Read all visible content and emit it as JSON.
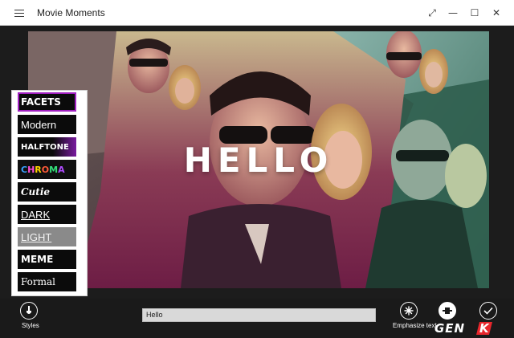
{
  "window": {
    "title": "Movie Moments",
    "menu_icon": "hamburger-icon",
    "controls": [
      "expand-icon",
      "minimize-icon",
      "maximize-icon",
      "close-icon"
    ],
    "control_glyphs": {
      "expand": "⤢",
      "minimize": "—",
      "maximize": "☐",
      "close": "✕"
    }
  },
  "preview": {
    "overlay_text": "HELLO"
  },
  "styles_panel": {
    "items": [
      {
        "label": "FACETS",
        "selected": true
      },
      {
        "label": "Modern",
        "selected": false
      },
      {
        "label": "HALFTONE",
        "selected": false
      },
      {
        "label": "CHROMA",
        "selected": false
      },
      {
        "label": "Cutie",
        "selected": false
      },
      {
        "label": "DARK",
        "selected": false
      },
      {
        "label": "LIGHT",
        "selected": false
      },
      {
        "label": "MEME",
        "selected": false
      },
      {
        "label": "Formal",
        "selected": false
      }
    ],
    "selection_color": "#a020c0",
    "chroma_colors": [
      "#3aa0ff",
      "#ff4fd8",
      "#ffd400",
      "#ff5a3a",
      "#34e07a",
      "#b04cff"
    ]
  },
  "bottom_bar": {
    "styles_button": {
      "label": "Styles",
      "icon": "brush-icon"
    },
    "text_input": {
      "value": "Hello"
    },
    "emphasize_button": {
      "label": "Emphasize text",
      "icon": "sparkle-icon"
    },
    "middle_button": {
      "icon": "text-position-icon"
    },
    "done_button": {
      "icon": "check-icon"
    }
  },
  "watermark": {
    "text": "GENK",
    "icon": "genk-logo"
  }
}
